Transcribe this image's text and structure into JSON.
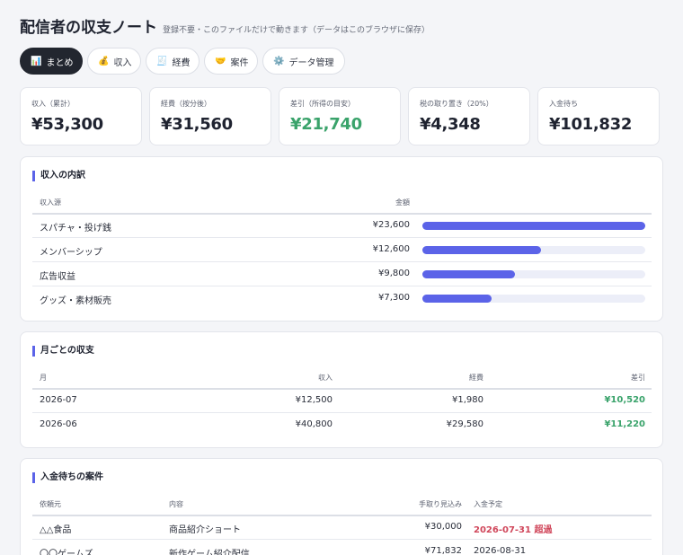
{
  "header": {
    "title": "配信者の収支ノート",
    "subtitle": "登録不要・このファイルだけで動きます（データはこのブラウザに保存）"
  },
  "tabs": [
    {
      "icon": "📊",
      "label": "まとめ"
    },
    {
      "icon": "💰",
      "label": "収入"
    },
    {
      "icon": "🧾",
      "label": "経費"
    },
    {
      "icon": "🤝",
      "label": "案件"
    },
    {
      "icon": "⚙️",
      "label": "データ管理"
    }
  ],
  "stats": [
    {
      "label": "収入（累計）",
      "value": "¥53,300"
    },
    {
      "label": "経費（按分後）",
      "value": "¥31,560"
    },
    {
      "label": "差引（所得の目安）",
      "value": "¥21,740"
    },
    {
      "label": "税の取り置き（20%）",
      "value": "¥4,348"
    },
    {
      "label": "入金待ち",
      "value": "¥101,832"
    }
  ],
  "income_breakdown": {
    "title": "収入の内訳",
    "headers": {
      "source": "収入源",
      "amount": "金額"
    },
    "rows": [
      {
        "source": "スパチャ・投げ銭",
        "amount": "¥23,600",
        "share": 1.0
      },
      {
        "source": "メンバーシップ",
        "amount": "¥12,600",
        "share": 0.534
      },
      {
        "source": "広告収益",
        "amount": "¥9,800",
        "share": 0.415
      },
      {
        "source": "グッズ・素材販売",
        "amount": "¥7,300",
        "share": 0.309
      }
    ]
  },
  "monthly": {
    "title": "月ごとの収支",
    "headers": {
      "month": "月",
      "income": "収入",
      "expense": "経費",
      "net": "差引"
    },
    "rows": [
      {
        "month": "2026-07",
        "income": "¥12,500",
        "expense": "¥1,980",
        "net": "¥10,520"
      },
      {
        "month": "2026-06",
        "income": "¥40,800",
        "expense": "¥29,580",
        "net": "¥11,220"
      }
    ]
  },
  "pending": {
    "title": "入金待ちの案件",
    "headers": {
      "client": "依頼元",
      "content": "内容",
      "expected": "手取り見込み",
      "due": "入金予定"
    },
    "rows": [
      {
        "client": "△△食品",
        "content": "商品紹介ショート",
        "expected": "¥30,000",
        "due": "2026-07-31",
        "status": "超過"
      },
      {
        "client": "〇〇ゲームズ",
        "content": "新作ゲーム紹介配信",
        "expected": "¥71,832",
        "due": "2026-08-31",
        "status": ""
      }
    ]
  }
}
